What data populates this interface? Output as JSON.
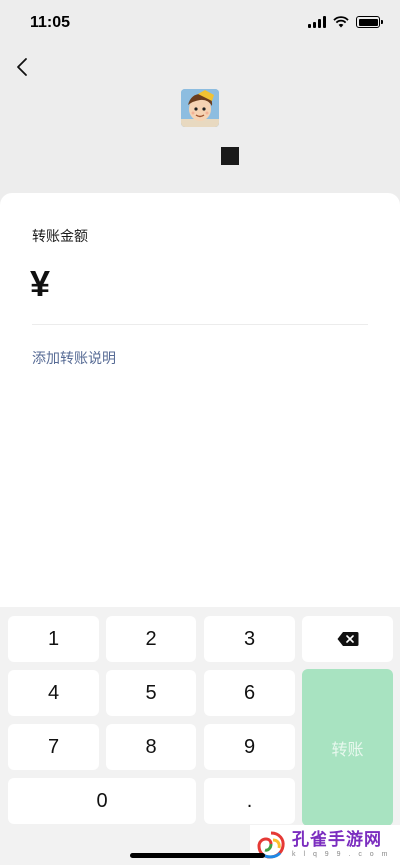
{
  "status_bar": {
    "time": "11:05"
  },
  "header": {
    "back_icon": "chevron-left-icon",
    "avatar_icon": "cartoon-boy-avatar"
  },
  "form": {
    "amount_label": "转账金额",
    "currency_symbol": "¥",
    "add_note_label": "添加转账说明"
  },
  "keypad": {
    "keys": [
      "1",
      "2",
      "3",
      "4",
      "5",
      "6",
      "7",
      "8",
      "9",
      "0",
      "."
    ],
    "backspace_icon": "backspace-icon",
    "transfer_label": "转账"
  },
  "watermark": {
    "name": "孔雀手游网",
    "domain": "k l q 9 9 . c o m"
  },
  "colors": {
    "link": "#576b95",
    "transfer_button": "#a8e3c1",
    "background": "#ededed"
  }
}
